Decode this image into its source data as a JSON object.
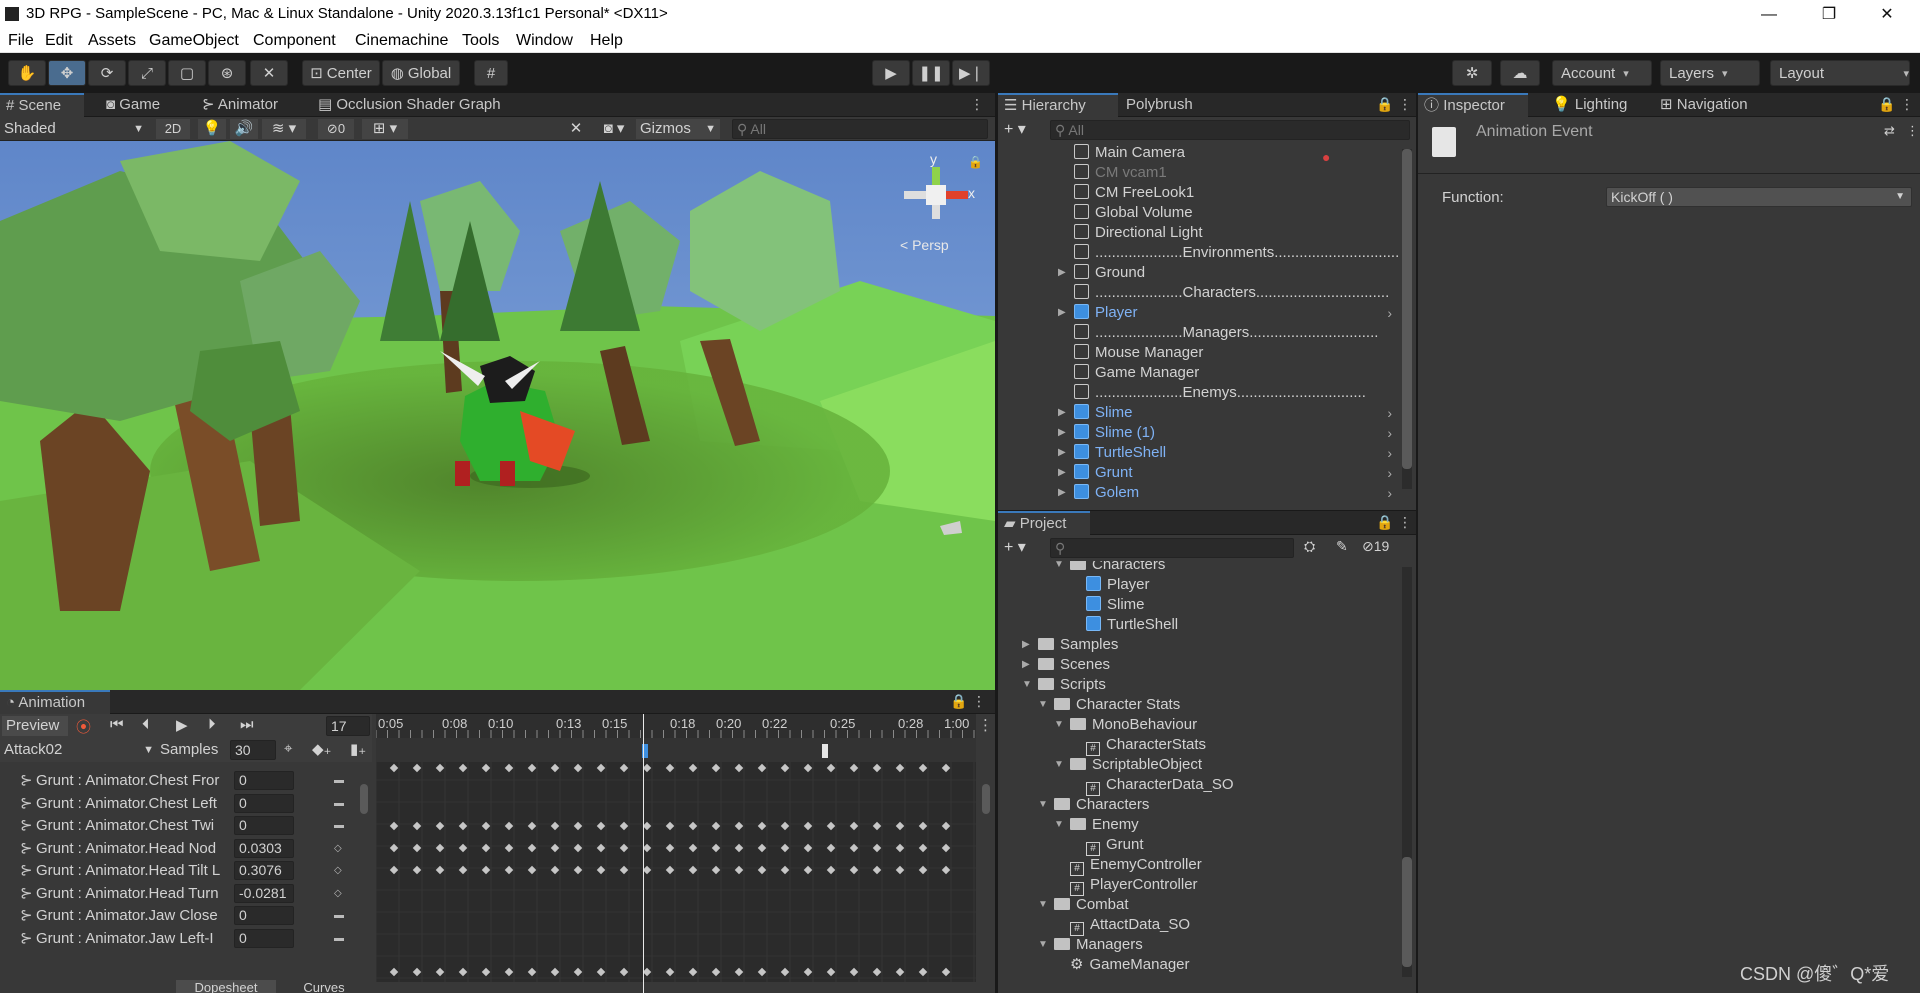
{
  "window": {
    "title": "3D RPG - SampleScene - PC, Mac & Linux Standalone - Unity 2020.3.13f1c1 Personal* <DX11>",
    "controls": {
      "minimize": "—",
      "maximize": "❐",
      "close": "✕"
    }
  },
  "menu": [
    "File",
    "Edit",
    "Assets",
    "GameObject",
    "Component",
    "Cinemachine",
    "Tools",
    "Window",
    "Help"
  ],
  "toolbar": {
    "pivot": "Center",
    "space": "Global",
    "account": "Account",
    "layers": "Layers",
    "layout": "Layout"
  },
  "scene": {
    "tabs": [
      "Scene",
      "Game",
      "Animator",
      "Occlusion Shader Graph"
    ],
    "draw_mode": "Shaded",
    "mode_2d": "2D",
    "hidden_count": "0",
    "gizmos": "Gizmos",
    "search_placeholder": "All",
    "persp_label": "< Persp",
    "axis_y": "y",
    "axis_x": "x"
  },
  "hierarchy": {
    "tabs": [
      "Hierarchy",
      "Polybrush"
    ],
    "search_placeholder": "All",
    "items": [
      {
        "label": "Main Camera",
        "style": "normal",
        "arrow": false,
        "child": false
      },
      {
        "label": "CM vcam1",
        "style": "dim",
        "arrow": false,
        "child": false
      },
      {
        "label": "CM FreeLook1",
        "style": "normal",
        "arrow": false,
        "child": false
      },
      {
        "label": "Global Volume",
        "style": "normal",
        "arrow": false,
        "child": false
      },
      {
        "label": "Directional Light",
        "style": "normal",
        "arrow": false,
        "child": false
      },
      {
        "label": ".....................Environments...............................",
        "style": "normal",
        "arrow": false,
        "child": false
      },
      {
        "label": "Ground",
        "style": "normal",
        "arrow": true,
        "child": false
      },
      {
        "label": ".....................Characters................................",
        "style": "normal",
        "arrow": false,
        "child": false
      },
      {
        "label": "Player",
        "style": "blue",
        "arrow": true,
        "child": true
      },
      {
        "label": ".....................Managers...............................",
        "style": "normal",
        "arrow": false,
        "child": false
      },
      {
        "label": "Mouse Manager",
        "style": "normal",
        "arrow": false,
        "child": false
      },
      {
        "label": "Game Manager",
        "style": "normal",
        "arrow": false,
        "child": false
      },
      {
        "label": ".....................Enemys...............................",
        "style": "normal",
        "arrow": false,
        "child": false
      },
      {
        "label": "Slime",
        "style": "blue",
        "arrow": true,
        "child": true
      },
      {
        "label": "Slime (1)",
        "style": "blue",
        "arrow": true,
        "child": true
      },
      {
        "label": "TurtleShell",
        "style": "blue",
        "arrow": true,
        "child": true
      },
      {
        "label": "Grunt",
        "style": "blue",
        "arrow": true,
        "child": true
      },
      {
        "label": "Golem",
        "style": "blue",
        "arrow": true,
        "child": true
      }
    ]
  },
  "project": {
    "tab": "Project",
    "hidden_count": "19",
    "items": [
      {
        "label": "Characters",
        "indent": 3,
        "type": "folder-open",
        "arrow": "down"
      },
      {
        "label": "Player",
        "indent": 4,
        "type": "prefab",
        "arrow": ""
      },
      {
        "label": "Slime",
        "indent": 4,
        "type": "prefab",
        "arrow": ""
      },
      {
        "label": "TurtleShell",
        "indent": 4,
        "type": "prefab",
        "arrow": ""
      },
      {
        "label": "Samples",
        "indent": 1,
        "type": "folder",
        "arrow": "right"
      },
      {
        "label": "Scenes",
        "indent": 1,
        "type": "folder",
        "arrow": "right"
      },
      {
        "label": "Scripts",
        "indent": 1,
        "type": "folder-open",
        "arrow": "down"
      },
      {
        "label": "Character Stats",
        "indent": 2,
        "type": "folder-open",
        "arrow": "down"
      },
      {
        "label": "MonoBehaviour",
        "indent": 3,
        "type": "folder-open",
        "arrow": "down"
      },
      {
        "label": "CharacterStats",
        "indent": 4,
        "type": "script",
        "arrow": ""
      },
      {
        "label": "ScriptableObject",
        "indent": 3,
        "type": "folder-open",
        "arrow": "down"
      },
      {
        "label": "CharacterData_SO",
        "indent": 4,
        "type": "script",
        "arrow": ""
      },
      {
        "label": "Characters",
        "indent": 2,
        "type": "folder-open",
        "arrow": "down"
      },
      {
        "label": "Enemy",
        "indent": 3,
        "type": "folder-open",
        "arrow": "down"
      },
      {
        "label": "Grunt",
        "indent": 4,
        "type": "script",
        "arrow": ""
      },
      {
        "label": "EnemyController",
        "indent": 3,
        "type": "script",
        "arrow": ""
      },
      {
        "label": "PlayerController",
        "indent": 3,
        "type": "script",
        "arrow": ""
      },
      {
        "label": "Combat",
        "indent": 2,
        "type": "folder-open",
        "arrow": "down"
      },
      {
        "label": "AttactData_SO",
        "indent": 3,
        "type": "script",
        "arrow": ""
      },
      {
        "label": "Managers",
        "indent": 2,
        "type": "folder-open",
        "arrow": "down"
      },
      {
        "label": "GameManager",
        "indent": 3,
        "type": "gear",
        "arrow": ""
      }
    ]
  },
  "inspector": {
    "tabs": [
      "Inspector",
      "Lighting",
      "Navigation"
    ],
    "header": "Animation Event",
    "function_label": "Function:",
    "function_value": "KickOff ( )"
  },
  "animation": {
    "tab": "Animation",
    "preview": "Preview",
    "frame": "17",
    "clip": "Attack02",
    "samples_label": "Samples",
    "samples": "30",
    "ruler": [
      "0:05",
      "0:08",
      "0:10",
      "0:13",
      "0:15",
      "0:18",
      "0:20",
      "0:22",
      "0:25",
      "0:28",
      "1:00"
    ],
    "properties": [
      {
        "name": "Grunt : Animator.Chest Fror",
        "value": "0"
      },
      {
        "name": "Grunt : Animator.Chest Left",
        "value": "0"
      },
      {
        "name": "Grunt : Animator.Chest Twi",
        "value": "0"
      },
      {
        "name": "Grunt : Animator.Head Nod",
        "value": "0.0303"
      },
      {
        "name": "Grunt : Animator.Head Tilt L",
        "value": "0.3076"
      },
      {
        "name": "Grunt : Animator.Head Turn",
        "value": "-0.0281"
      },
      {
        "name": "Grunt : Animator.Jaw Close",
        "value": "0"
      },
      {
        "name": "Grunt : Animator.Jaw Left-I",
        "value": "0"
      }
    ],
    "bottom_tabs": [
      "Dopesheet",
      "Curves"
    ]
  },
  "watermark": "CSDN @傻゛Q*爱",
  "colors": {
    "accent": "#3a79bb",
    "blue_label": "#7fb2f5",
    "panel": "#383838"
  }
}
